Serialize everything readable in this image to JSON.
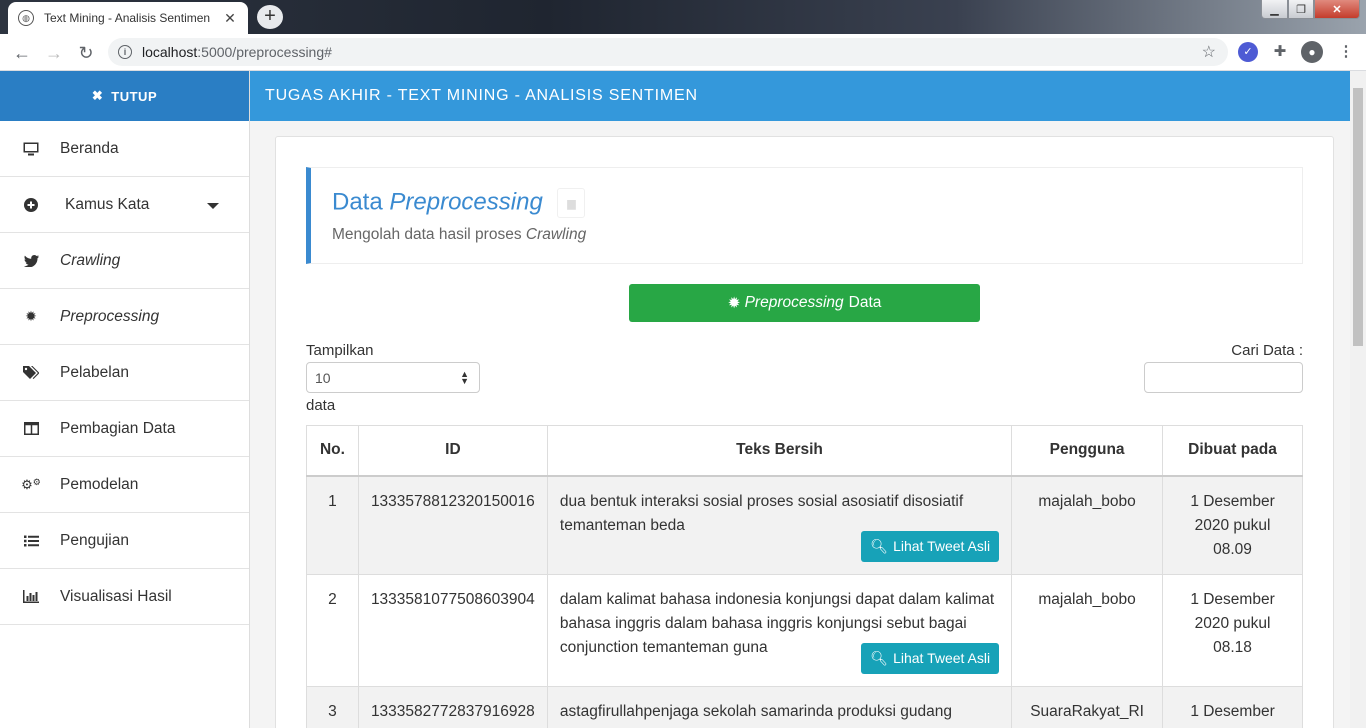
{
  "browser": {
    "tab_title": "Text Mining - Analisis Sentimen",
    "new_tab": "+",
    "url_host": "localhost",
    "url_path": ":5000/preprocessing#"
  },
  "app": {
    "title": "TUGAS AKHIR - TEXT MINING - ANALISIS SENTIMEN",
    "close_label": "TUTUP",
    "accent": "#3498db",
    "sidebar_header_color": "#2a7ec4"
  },
  "sidebar": {
    "items": [
      {
        "label": "Beranda",
        "icon": "monitor-icon"
      },
      {
        "label": "Kamus Kata",
        "icon": "plus-circle-icon"
      },
      {
        "label": "Crawling",
        "icon": "twitter-icon"
      },
      {
        "label": "Preprocessing",
        "icon": "gear-icon"
      },
      {
        "label": "Pelabelan",
        "icon": "tags-icon"
      },
      {
        "label": "Pembagian Data",
        "icon": "columns-icon"
      },
      {
        "label": "Pemodelan",
        "icon": "cogs-icon"
      },
      {
        "label": "Pengujian",
        "icon": "list-icon"
      },
      {
        "label": "Visualisasi Hasil",
        "icon": "bar-chart-icon"
      }
    ]
  },
  "page": {
    "title_word": "Data",
    "title_italic": "Preprocessing",
    "subtitle": "Mengolah data hasil proses",
    "subtitle_italic": "Crawling",
    "action_italic": "Preprocessing",
    "action_rest": "Data",
    "action_color": "#28a745"
  },
  "table_controls": {
    "show_label": "Tampilkan",
    "show_value": "10",
    "show_suffix": "data",
    "search_label": "Cari Data :"
  },
  "table": {
    "columns": [
      "No.",
      "ID",
      "Teks Bersih",
      "Pengguna",
      "Dibuat pada"
    ],
    "view_button": "Lihat Tweet Asli",
    "rows": [
      {
        "no": "1",
        "id": "1333578812320150016",
        "text": "dua bentuk interaksi sosial proses sosial asosiatif disosiatif temanteman beda",
        "user": "majalah_bobo",
        "date": "1 Desember 2020 pukul 08.09"
      },
      {
        "no": "2",
        "id": "1333581077508603904",
        "text": "dalam kalimat bahasa indonesia konjungsi dapat dalam kalimat bahasa inggris dalam bahasa inggris konjungsi sebut bagai conjunction temanteman guna",
        "user": "majalah_bobo",
        "date": "1 Desember 2020 pukul 08.18"
      },
      {
        "no": "3",
        "id": "1333582772837916928",
        "text": "astagfirullahpenjaga sekolah samarinda produksi gudang",
        "user": "SuaraRakyat_RI",
        "date": "1 Desember"
      }
    ]
  }
}
